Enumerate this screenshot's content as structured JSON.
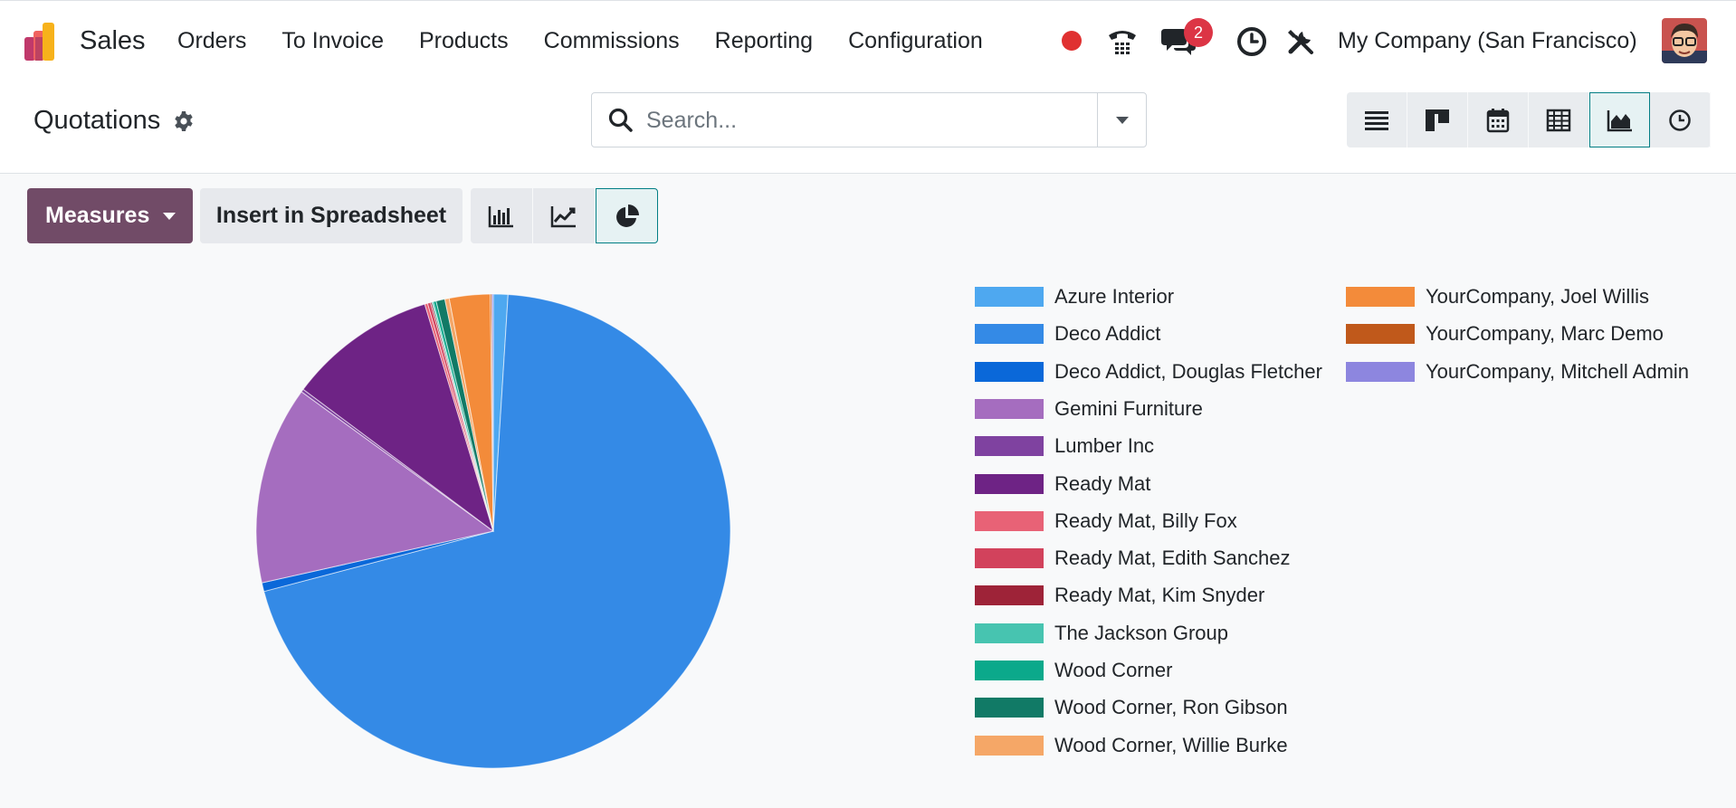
{
  "app": {
    "name": "Sales",
    "menu": [
      "Orders",
      "To Invoice",
      "Products",
      "Commissions",
      "Reporting",
      "Configuration"
    ],
    "messages_badge": "2",
    "company": "My Company (San Francisco)"
  },
  "control_panel": {
    "breadcrumb": "Quotations",
    "search_placeholder": "Search..."
  },
  "toolbar": {
    "measures_label": "Measures",
    "spreadsheet_label": "Insert in Spreadsheet"
  },
  "colors": {
    "brand": "#714b67",
    "accent": "#017e84"
  },
  "chart_data": {
    "type": "pie",
    "series": [
      {
        "name": "Azure Interior",
        "value": 1.0,
        "color": "#4ea8f0"
      },
      {
        "name": "Deco Addict",
        "value": 70.4,
        "color": "#348ae6"
      },
      {
        "name": "Deco Addict, Douglas Fletcher",
        "value": 0.6,
        "color": "#0a68d9"
      },
      {
        "name": "Gemini Furniture",
        "value": 13.6,
        "color": "#a56dbf"
      },
      {
        "name": "Lumber Inc",
        "value": 0.2,
        "color": "#7f42a0"
      },
      {
        "name": "Ready Mat",
        "value": 10.2,
        "color": "#6e2385"
      },
      {
        "name": "Ready Mat, Billy Fox",
        "value": 0.2,
        "color": "#e86276"
      },
      {
        "name": "Ready Mat, Edith Sanchez",
        "value": 0.2,
        "color": "#d2425c"
      },
      {
        "name": "Ready Mat, Kim Snyder",
        "value": 0.1,
        "color": "#9e2338"
      },
      {
        "name": "The Jackson Group",
        "value": 0.1,
        "color": "#47c4b0"
      },
      {
        "name": "Wood Corner",
        "value": 0.2,
        "color": "#0ba98b"
      },
      {
        "name": "Wood Corner, Ron Gibson",
        "value": 0.6,
        "color": "#117a66"
      },
      {
        "name": "Wood Corner, Willie Burke",
        "value": 0.3,
        "color": "#f5a767"
      },
      {
        "name": "YourCompany, Joel Willis",
        "value": 2.8,
        "color": "#f38b3a"
      },
      {
        "name": "YourCompany, Marc Demo",
        "value": 0.1,
        "color": "#c0591b"
      },
      {
        "name": "YourCompany, Mitchell Admin",
        "value": 0.1,
        "color": "#8d86df"
      }
    ],
    "legend_placement": "right"
  }
}
